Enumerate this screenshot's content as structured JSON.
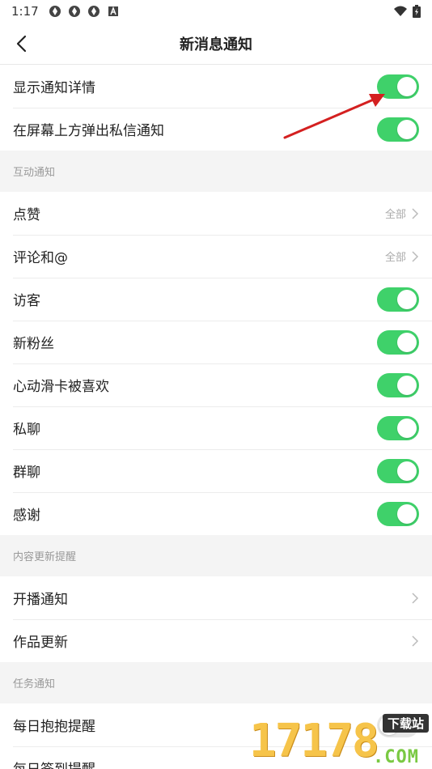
{
  "status_bar": {
    "time": "1:17",
    "icons": [
      "app-notification-icon",
      "app-notification-icon",
      "app-notification-icon",
      "a-icon"
    ],
    "right_icons": [
      "wifi-icon",
      "battery-icon"
    ]
  },
  "header": {
    "title": "新消息通知",
    "back_icon": "back-arrow-icon"
  },
  "top_settings": [
    {
      "label": "显示通知详情",
      "toggle": "on"
    },
    {
      "label": "在屏幕上方弹出私信通知",
      "toggle": "on"
    }
  ],
  "sections": {
    "interaction": {
      "title": "互动通知",
      "items": [
        {
          "label": "点赞",
          "value": "全部"
        },
        {
          "label": "评论和@",
          "value": "全部"
        },
        {
          "label": "访客",
          "toggle": "on"
        },
        {
          "label": "新粉丝",
          "toggle": "on"
        },
        {
          "label": "心动滑卡被喜欢",
          "toggle": "on"
        },
        {
          "label": "私聊",
          "toggle": "on"
        },
        {
          "label": "群聊",
          "toggle": "on"
        },
        {
          "label": "感谢",
          "toggle": "on"
        }
      ]
    },
    "content": {
      "title": "内容更新提醒",
      "items": [
        {
          "label": "开播通知"
        },
        {
          "label": "作品更新"
        }
      ]
    },
    "task": {
      "title": "任务通知",
      "items": [
        {
          "label": "每日抱抱提醒",
          "toggle": "off"
        },
        {
          "label": "每日签到提醒"
        }
      ]
    }
  },
  "watermark": {
    "number": "17178",
    "badge": "下载站",
    "suffix": ".COM"
  },
  "colors": {
    "toggle_on": "#3fd16a",
    "toggle_off": "#e6e6e6",
    "annotation_arrow": "#d42020",
    "background": "#f4f4f4"
  }
}
